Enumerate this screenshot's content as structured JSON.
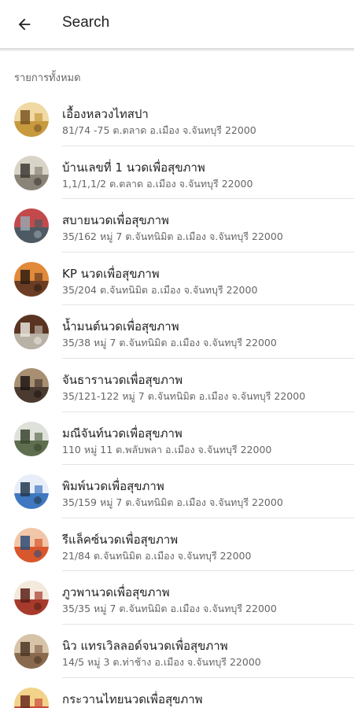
{
  "header": {
    "title": "Search",
    "back_icon": "arrow-left-icon"
  },
  "section_label": "รายการทั้งหมด",
  "items": [
    {
      "name": "เอื้องหลวงไทสปา",
      "address": "81/74 -75 ต.ตลาด อ.เมือง จ.จันทบุรี 22000",
      "thumb_colors": [
        "#c79a3e",
        "#f0d9a3",
        "#7a5524"
      ]
    },
    {
      "name": "บ้านเลขที่ 1 นวดเพื่อสุขภาพ",
      "address": "1,1/1,1/2 ต.ตลาด อ.เมือง จ.จันทบุรี 22000",
      "thumb_colors": [
        "#8a8378",
        "#d9d4c8",
        "#3e3a34"
      ]
    },
    {
      "name": "สบายนวดเพื่อสุขภาพ",
      "address": "35/162 หมู่ 7 ต.จันทนิมิต อ.เมือง จ.จันทบุรี 22000",
      "thumb_colors": [
        "#4e5a63",
        "#c24a4a",
        "#9aa5ad"
      ]
    },
    {
      "name": "KP นวดเพื่อสุขภาพ",
      "address": "35/204 ต.จันทนิมิต อ.เมือง จ.จันทบุรี 22000",
      "thumb_colors": [
        "#6b3d24",
        "#e08a3a",
        "#2e1c12"
      ]
    },
    {
      "name": "น้ำมนต์นวดเพื่อสุขภาพ",
      "address": "35/38 หมู่ 7 ต.จันทนิมิต อ.เมือง จ.จันทบุรี 22000",
      "thumb_colors": [
        "#b8b1a6",
        "#5a3422",
        "#e8e3da"
      ]
    },
    {
      "name": "จันธารานวดเพื่อสุขภาพ",
      "address": "35/121-122 หมู่ 7 ต.จันทนิมิต อ.เมือง จ.จันทบุรี 22000",
      "thumb_colors": [
        "#4a3a30",
        "#a88f72",
        "#1f1814"
      ]
    },
    {
      "name": "มณีจันท์นวดเพื่อสุขภาพ",
      "address": "110 หมู่ 11 ต.พลับพลา อ.เมือง จ.จันทบุรี 22000",
      "thumb_colors": [
        "#5e6e4e",
        "#dfe2da",
        "#3b4530"
      ]
    },
    {
      "name": "พิมพ์นวดเพื่อสุขภาพ",
      "address": "35/159 หมู่ 7 ต.จันทนิมิต อ.เมือง จ.จันทบุรี 22000",
      "thumb_colors": [
        "#3f78c0",
        "#e7eef7",
        "#23384f"
      ]
    },
    {
      "name": "รีแล็คซ์นวดเพื่อสุขภาพ",
      "address": "21/84 ต.จันทนิมิต อ.เมือง จ.จันทบุรี 22000",
      "thumb_colors": [
        "#d9572c",
        "#f2c6a8",
        "#2e4d7a"
      ]
    },
    {
      "name": "ภูวพานวดเพื่อสุขภาพ",
      "address": "35/35 หมู่ 7 ต.จันทนิมิต อ.เมือง จ.จันทบุรี 22000",
      "thumb_colors": [
        "#a73a2c",
        "#f3e9dc",
        "#5a2018"
      ]
    },
    {
      "name": "นิว แทรเวิลลอด์จนวดเพื่อสุขภาพ",
      "address": "14/5 หมู่ 3 ต.ท่าช้าง อ.เมือง จ.จันทบุรี 22000",
      "thumb_colors": [
        "#8a6a4e",
        "#d7c3a8",
        "#4c3626"
      ]
    },
    {
      "name": "กระวานไทยนวดเพื่อสุขภาพ",
      "address": "",
      "thumb_colors": [
        "#c94a3a",
        "#f2d38a",
        "#6b2a20"
      ]
    }
  ]
}
